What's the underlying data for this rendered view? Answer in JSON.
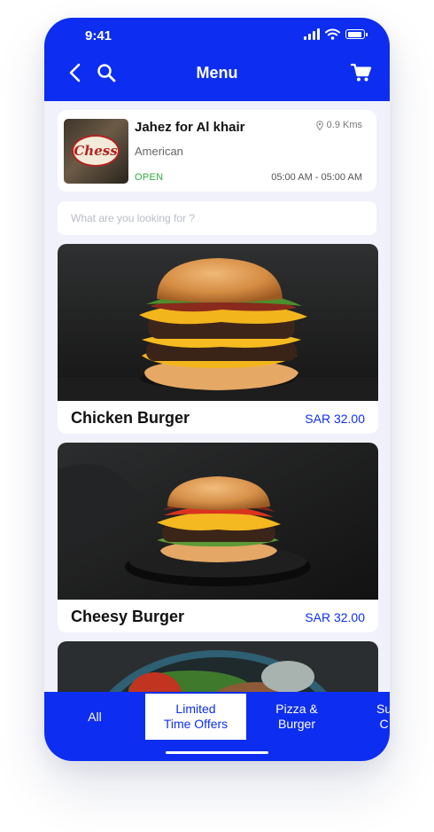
{
  "status_bar": {
    "time": "9:41"
  },
  "header": {
    "title": "Menu"
  },
  "restaurant": {
    "logo_text": "Chess",
    "name": "Jahez for Al khair",
    "cuisine": "American",
    "status": "OPEN",
    "distance": "0.9 Kms",
    "hours": "05:00 AM - 05:00 AM"
  },
  "search": {
    "placeholder": "What are you looking for ?"
  },
  "items": [
    {
      "name": "Chicken Burger",
      "price": "SAR 32.00"
    },
    {
      "name": "Cheesy Burger",
      "price": "SAR 32.00"
    }
  ],
  "tabs": [
    {
      "label": "All"
    },
    {
      "label": "Limited\nTime Offers",
      "active": true
    },
    {
      "label": "Pizza &\nBurger"
    },
    {
      "label": "Su\nC"
    }
  ],
  "colors": {
    "primary": "#0d2ef0",
    "open": "#2eac3e",
    "background": "#f0f1fb"
  },
  "icons": [
    "back-icon",
    "search-icon",
    "cart-icon",
    "location-pin-icon"
  ]
}
